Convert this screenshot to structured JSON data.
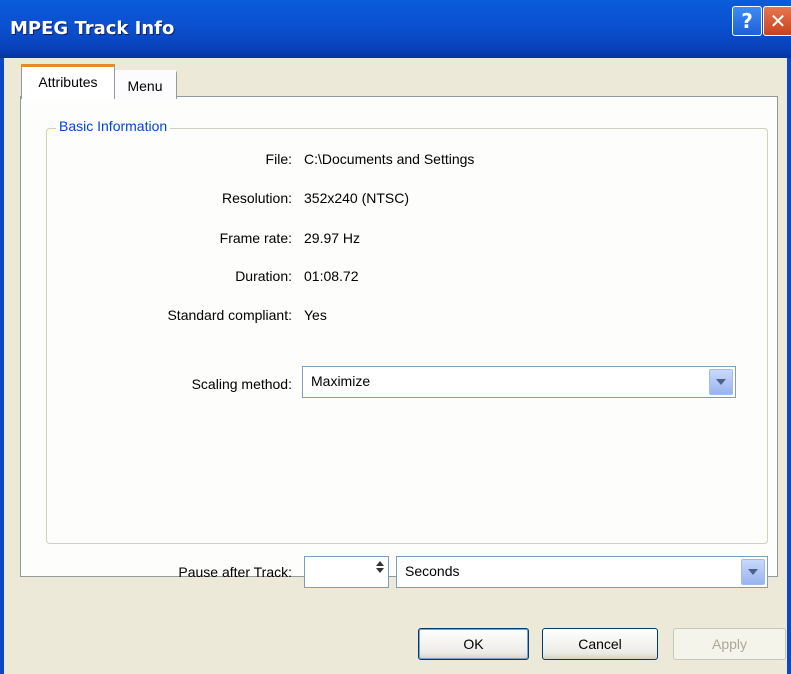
{
  "window": {
    "title": "MPEG Track Info",
    "help_label": "?",
    "close_label": "✕"
  },
  "tabs": [
    {
      "label": "Attributes",
      "selected": true
    },
    {
      "label": "Menu",
      "selected": false
    }
  ],
  "group": {
    "title": "Basic Information"
  },
  "fields": {
    "file": {
      "label": "File:",
      "value": "C:\\Documents and Settings"
    },
    "resolution": {
      "label": "Resolution:",
      "value": "352x240 (NTSC)"
    },
    "frame_rate": {
      "label": "Frame rate:",
      "value": "29.97 Hz"
    },
    "duration": {
      "label": "Duration:",
      "value": "01:08.72"
    },
    "standard": {
      "label": "Standard compliant:",
      "value": "Yes"
    }
  },
  "scaling": {
    "label": "Scaling method:",
    "selected": "Maximize"
  },
  "pause": {
    "label": "Pause after Track:",
    "value": "",
    "unit": "Seconds"
  },
  "buttons": {
    "ok": "OK",
    "cancel": "Cancel",
    "apply": "Apply"
  },
  "icons": [
    "help-icon",
    "close-icon",
    "chevron-down-icon",
    "spin-arrows-icon"
  ],
  "colors": {
    "titlebar": "#0B4FCE",
    "group_title": "#0046D5",
    "selected_tab_accent": "#E68B2C",
    "dialog_bg": "#ECE9D8"
  }
}
